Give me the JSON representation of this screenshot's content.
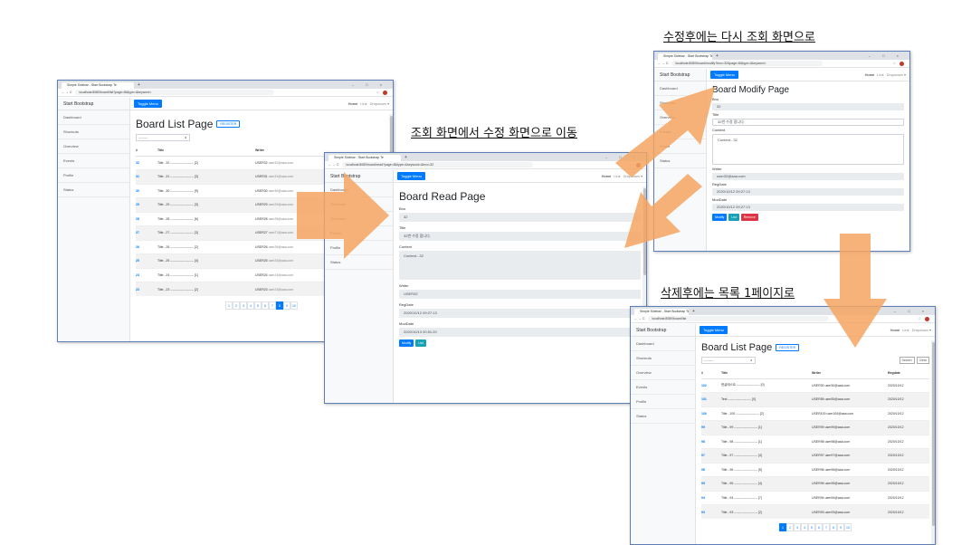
{
  "captions": {
    "read_to_modify": "조회 화면에서 수정 화면으로 이동",
    "modify_to_read": "수정후에는 다시 조회 화면으로",
    "delete_to_list": "삭제후에는 목록 1페이지로"
  },
  "colors": {
    "arrow": "#f4a460",
    "primary": "#007bff",
    "info": "#17a2b8",
    "danger": "#dc3545"
  },
  "browser": {
    "tab_title": "Simple Sidebar - Start Bootstrap Te",
    "tab_plus": "+",
    "controls": "– □ ×",
    "nav_icons": "← → C",
    "list_url": "localhost:8080/board/list?page=8&type=&keyword=",
    "read_url": "localhost:8080/board/read?page=8&type=&keyword=&bno=32",
    "modify_url": "localhost:8080/board/modify?bno=32&page=8&type=&keyword=",
    "list2_url": "localhost:8080/board/list"
  },
  "app": {
    "brand": "Start Bootstrap",
    "sidebar": [
      "Dashboard",
      "Shortcuts",
      "Overview",
      "Events",
      "Profile",
      "Status"
    ],
    "toggle": "Toggle Menu",
    "nav": {
      "home": "Home",
      "link": "Link",
      "dropdown": "Dropdown ▾"
    }
  },
  "list_page": {
    "title": "Board List Page",
    "register": "REGISTER",
    "select_placeholder": "---------",
    "columns": [
      "#",
      "Title",
      "Writer",
      "Regdate"
    ],
    "rows": [
      {
        "bno": "32",
        "title": "Title...32 ---------------------- [2]",
        "writer": "USER32",
        "email": "user32@aaa.com"
      },
      {
        "bno": "31",
        "title": "Title...31 ---------------------- [3]",
        "writer": "USER31",
        "email": "user31@aaa.com"
      },
      {
        "bno": "30",
        "title": "Title...30 ---------------------- [9]",
        "writer": "USER30",
        "email": "user30@aaa.com"
      },
      {
        "bno": "29",
        "title": "Title...29 ---------------------- [3]",
        "writer": "USER29",
        "email": "user29@aaa.com"
      },
      {
        "bno": "28",
        "title": "Title...28 ---------------------- [6]",
        "writer": "USER28",
        "email": "user28@aaa.com"
      },
      {
        "bno": "27",
        "title": "Title...27 ---------------------- [3]",
        "writer": "USER27",
        "email": "user27@aaa.com"
      },
      {
        "bno": "26",
        "title": "Title...26 ---------------------- [2]",
        "writer": "USER26",
        "email": "user26@aaa.com"
      },
      {
        "bno": "25",
        "title": "Title...25 ---------------------- [4]",
        "writer": "USER25",
        "email": "user25@aaa.com"
      },
      {
        "bno": "24",
        "title": "Title...24 ---------------------- [1]",
        "writer": "USER24",
        "email": "user24@aaa.com"
      },
      {
        "bno": "23",
        "title": "Title...23 ---------------------- [2]",
        "writer": "USER23",
        "email": "user23@aaa.com"
      }
    ],
    "pages": [
      "1",
      "2",
      "3",
      "4",
      "5",
      "6",
      "7",
      "8",
      "9",
      "10"
    ],
    "active_page": "8"
  },
  "read_page": {
    "title": "Board Read Page",
    "bno_label": "Bno",
    "bno": "32",
    "title_label": "Title",
    "title_value": "32번 수정 합니다.",
    "content_label": "Content",
    "content": "Content...32",
    "writer_label": "Writer",
    "writer": "USER32",
    "regdate_label": "RegDate",
    "regdate": "2020/10/12 09:27:13",
    "moddate_label": "ModDate",
    "moddate": "2020/10/13 00:51:20",
    "modify_btn": "Modify",
    "list_btn": "List"
  },
  "modify_page": {
    "title": "Board Modify Page",
    "bno_label": "Bno",
    "bno": "32",
    "title_label": "Title",
    "title_value": "32번 수정 합니다.",
    "content_label": "Content",
    "content": "Content...32",
    "writer_label": "Writer",
    "writer": "user32@aaa.com",
    "regdate_label": "RegDate",
    "regdate": "2020/10/12 09:27:13",
    "moddate_label": "ModDate",
    "moddate": "2020/10/12 09:27:13",
    "modify_btn": "Modify",
    "list_btn": "List",
    "remove_btn": "Remove"
  },
  "list_page2": {
    "title": "Board List Page",
    "register": "REGISTER",
    "select_placeholder": "---------",
    "search": "Search",
    "clear": "Clear",
    "columns": [
      "#",
      "Title",
      "Writer",
      "Regdate"
    ],
    "rows": [
      {
        "bno": "102",
        "title": "한글테스트 ---------------------- [0]",
        "writer": "USER30 user30@aaa.com",
        "date": "2020/10/12"
      },
      {
        "bno": "101",
        "title": "Test ---------------------- [0]",
        "writer": "USER55 user55@aaa.com",
        "date": "2020/10/12"
      },
      {
        "bno": "100",
        "title": "Title...100 ---------------------- [2]",
        "writer": "USER100 user100@aaa.com",
        "date": "2020/10/12"
      },
      {
        "bno": "99",
        "title": "Title...99 ---------------------- [1]",
        "writer": "USER99 user99@aaa.com",
        "date": "2020/10/12"
      },
      {
        "bno": "98",
        "title": "Title...98 ---------------------- [1]",
        "writer": "USER98 user98@aaa.com",
        "date": "2020/10/12"
      },
      {
        "bno": "97",
        "title": "Title...97 ---------------------- [4]",
        "writer": "USER97 user97@aaa.com",
        "date": "2020/10/12"
      },
      {
        "bno": "96",
        "title": "Title...96 ---------------------- [5]",
        "writer": "USER96 user96@aaa.com",
        "date": "2020/10/12"
      },
      {
        "bno": "95",
        "title": "Title...95 ---------------------- [4]",
        "writer": "USER95 user95@aaa.com",
        "date": "2020/10/12"
      },
      {
        "bno": "94",
        "title": "Title...94 ---------------------- [7]",
        "writer": "USER94 user94@aaa.com",
        "date": "2020/10/12"
      },
      {
        "bno": "93",
        "title": "Title...93 ---------------------- [2]",
        "writer": "USER93 user93@aaa.com",
        "date": "2020/10/12"
      }
    ],
    "pages": [
      "1",
      "2",
      "3",
      "4",
      "5",
      "6",
      "7",
      "8",
      "9",
      "10"
    ],
    "active_page": "1"
  }
}
